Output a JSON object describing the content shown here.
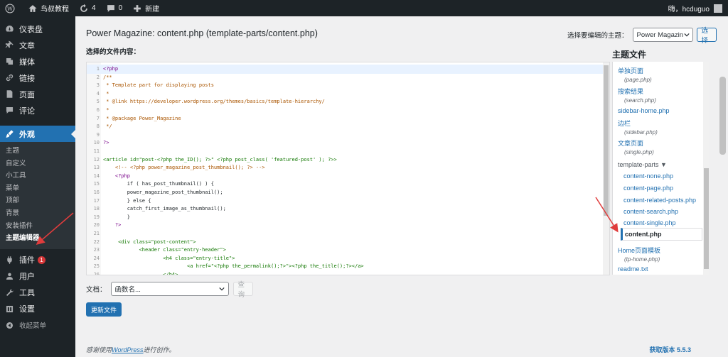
{
  "admin_bar": {
    "site_name": "鸟叔教程",
    "updates_count": "4",
    "comments_count": "0",
    "new_label": "新建",
    "user_greeting": "嗨，hcduguo"
  },
  "sidebar": {
    "items_top": [
      {
        "label": "仪表盘",
        "icon": "dashboard-icon"
      },
      {
        "label": "文章",
        "icon": "pin-icon"
      },
      {
        "label": "媒体",
        "icon": "media-icon"
      },
      {
        "label": "链接",
        "icon": "link-icon"
      },
      {
        "label": "页面",
        "icon": "page-icon"
      },
      {
        "label": "评论",
        "icon": "comment-icon"
      }
    ],
    "current": {
      "label": "外观",
      "icon": "brush-icon"
    },
    "submenu": [
      "主题",
      "自定义",
      "小工具",
      "菜单",
      "顶部",
      "背景",
      "安装插件",
      "主题编辑器"
    ],
    "items_bottom": [
      {
        "label": "插件",
        "icon": "plugin-icon",
        "badge": "1"
      },
      {
        "label": "用户",
        "icon": "users-icon"
      },
      {
        "label": "工具",
        "icon": "tools-icon"
      },
      {
        "label": "设置",
        "icon": "settings-icon"
      },
      {
        "label": "收起菜单",
        "icon": "collapse-icon"
      }
    ]
  },
  "header": {
    "title": "Power Magazine: content.php (template-parts/content.php)",
    "select_theme_label": "选择要编辑的主题：",
    "select_theme_value": "Power Magazin",
    "select_button": "选择",
    "content_label": "选择的文件内容："
  },
  "editor": {
    "lines": [
      {
        "n": "1",
        "t": "<?php",
        "c": "php"
      },
      {
        "n": "2",
        "t": "/**",
        "c": "com"
      },
      {
        "n": "3",
        "t": " * Template part for displaying posts",
        "c": "com"
      },
      {
        "n": "4",
        "t": " *",
        "c": "com"
      },
      {
        "n": "5",
        "t": " * @link https://developer.wordpress.org/themes/basics/template-hierarchy/",
        "c": "com"
      },
      {
        "n": "6",
        "t": " *",
        "c": "com"
      },
      {
        "n": "7",
        "t": " * @package Power_Magazine",
        "c": "com"
      },
      {
        "n": "8",
        "t": " */",
        "c": "com"
      },
      {
        "n": "9",
        "t": "",
        "c": "txt"
      },
      {
        "n": "10",
        "t": "?>",
        "c": "php"
      },
      {
        "n": "11",
        "t": "",
        "c": "txt"
      },
      {
        "n": "12",
        "t": "<article id=\"post-<?php the_ID(); ?>\" <?php post_class( 'featured-post' ); ?>>",
        "c": "tag"
      },
      {
        "n": "13",
        "t": "    <!-- <?php power_magazine_post_thumbnail(); ?> -->",
        "c": "com"
      },
      {
        "n": "14",
        "t": "    <?php",
        "c": "php"
      },
      {
        "n": "15",
        "t": "        if ( has_post_thumbnail() ) {",
        "c": "txt"
      },
      {
        "n": "16",
        "t": "        power_magazine_post_thumbnail();",
        "c": "txt"
      },
      {
        "n": "17",
        "t": "        } else {",
        "c": "txt"
      },
      {
        "n": "18",
        "t": "        catch_first_image_as_thumbnail();",
        "c": "txt"
      },
      {
        "n": "19",
        "t": "        }",
        "c": "txt"
      },
      {
        "n": "20",
        "t": "    ?>",
        "c": "php"
      },
      {
        "n": "21",
        "t": "",
        "c": "txt"
      },
      {
        "n": "22",
        "t": "     <div class=\"post-content\">",
        "c": "tag"
      },
      {
        "n": "23",
        "t": "            <header class=\"entry-header\">",
        "c": "tag"
      },
      {
        "n": "24",
        "t": "                    <h4 class=\"entry-title\">",
        "c": "tag"
      },
      {
        "n": "25",
        "t": "                            <a href=\"<?php the_permalink();?>\"><?php the_title();?></a>",
        "c": "tag"
      },
      {
        "n": "26",
        "t": "                    </h4>",
        "c": "tag"
      }
    ]
  },
  "files": {
    "title": "主题文件",
    "entries": [
      {
        "label": "单独页面",
        "file": "(page.php)"
      },
      {
        "label": "搜索结果",
        "file": "(search.php)"
      },
      {
        "label": "sidebar-home.php",
        "file": ""
      },
      {
        "label": "边栏",
        "file": "(sidebar.php)"
      },
      {
        "label": "文章页面",
        "file": "(single.php)"
      }
    ],
    "folder": "template-parts ▼",
    "sub_entries": [
      "content-none.php",
      "content-page.php",
      "content-related-posts.php",
      "content-search.php",
      "content-single.php"
    ],
    "current": "content.php",
    "after": [
      {
        "label": "Home页面模板",
        "file": "(tp-home.php)"
      },
      {
        "label": "readme.txt",
        "file": ""
      }
    ]
  },
  "footer_form": {
    "doc_label": "文档：",
    "function_placeholder": "函数名...",
    "lookup_button": "查询",
    "update_button": "更新文件"
  },
  "footer": {
    "thanks_prefix": "感谢使用",
    "wordpress_link": "WordPress",
    "thanks_suffix": "进行创作。",
    "version": "获取版本 5.5.3"
  },
  "colors": {
    "accent": "#2271b1",
    "arrow": "#e03c3c",
    "dark": "#1d2327"
  }
}
